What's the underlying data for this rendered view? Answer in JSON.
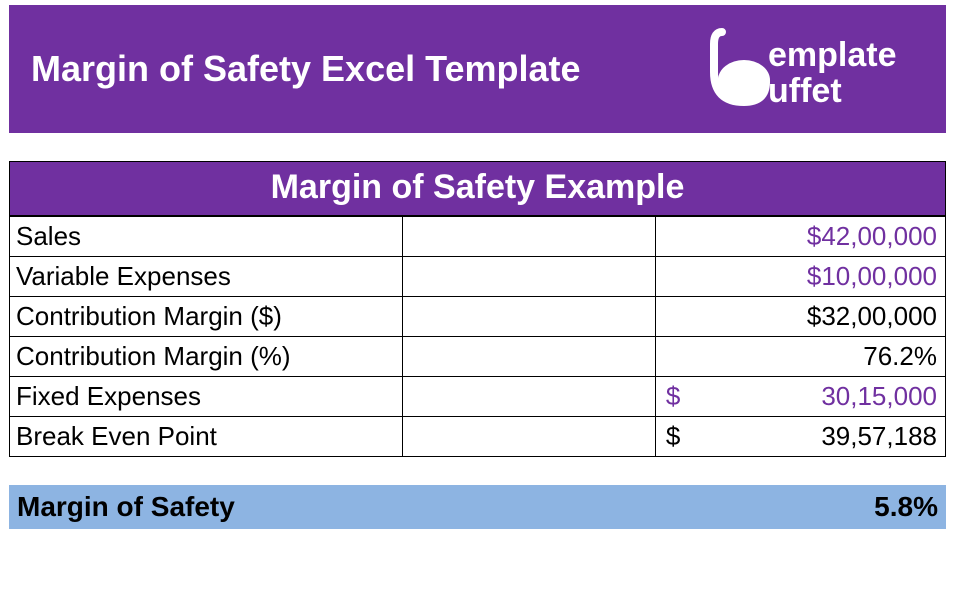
{
  "header": {
    "title": "Margin of Safety Excel Template",
    "logo_text_top": "emplate",
    "logo_text_bottom": "uffet"
  },
  "table": {
    "title": "Margin of Safety Example",
    "rows": [
      {
        "label": "Sales",
        "value": "$42,00,000",
        "purple": true,
        "split": false
      },
      {
        "label": "Variable Expenses",
        "value": "$10,00,000",
        "purple": true,
        "split": false
      },
      {
        "label": "Contribution Margin ($)",
        "value": "$32,00,000",
        "purple": false,
        "split": false
      },
      {
        "label": "Contribution Margin (%)",
        "value": "76.2%",
        "purple": false,
        "split": false
      },
      {
        "label": "Fixed Expenses",
        "symbol": "$",
        "value": "30,15,000",
        "purple": true,
        "split": true
      },
      {
        "label": "Break Even Point",
        "symbol": "$",
        "value": "39,57,188",
        "purple": false,
        "split": true
      }
    ]
  },
  "footer": {
    "label": "Margin of Safety",
    "value": "5.8%"
  },
  "colors": {
    "brand_purple": "#7030a0",
    "footer_blue": "#8db4e2"
  }
}
